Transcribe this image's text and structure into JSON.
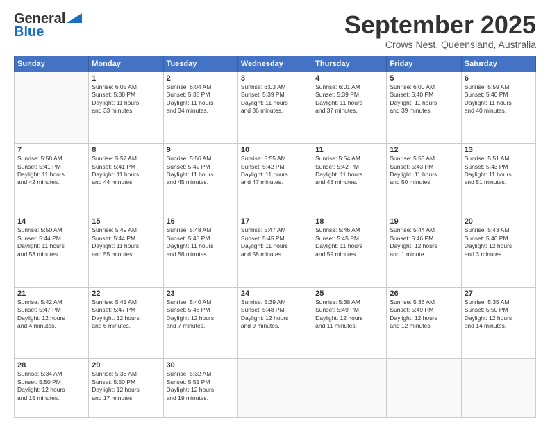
{
  "header": {
    "logo_line1": "General",
    "logo_line2": "Blue",
    "month": "September 2025",
    "location": "Crows Nest, Queensland, Australia"
  },
  "days": [
    "Sunday",
    "Monday",
    "Tuesday",
    "Wednesday",
    "Thursday",
    "Friday",
    "Saturday"
  ],
  "weeks": [
    [
      {
        "num": "",
        "info": ""
      },
      {
        "num": "1",
        "info": "Sunrise: 6:05 AM\nSunset: 5:38 PM\nDaylight: 11 hours\nand 33 minutes."
      },
      {
        "num": "2",
        "info": "Sunrise: 6:04 AM\nSunset: 5:38 PM\nDaylight: 11 hours\nand 34 minutes."
      },
      {
        "num": "3",
        "info": "Sunrise: 6:03 AM\nSunset: 5:39 PM\nDaylight: 11 hours\nand 36 minutes."
      },
      {
        "num": "4",
        "info": "Sunrise: 6:01 AM\nSunset: 5:39 PM\nDaylight: 11 hours\nand 37 minutes."
      },
      {
        "num": "5",
        "info": "Sunrise: 6:00 AM\nSunset: 5:40 PM\nDaylight: 11 hours\nand 39 minutes."
      },
      {
        "num": "6",
        "info": "Sunrise: 5:59 AM\nSunset: 5:40 PM\nDaylight: 11 hours\nand 40 minutes."
      }
    ],
    [
      {
        "num": "7",
        "info": "Sunrise: 5:58 AM\nSunset: 5:41 PM\nDaylight: 11 hours\nand 42 minutes."
      },
      {
        "num": "8",
        "info": "Sunrise: 5:57 AM\nSunset: 5:41 PM\nDaylight: 11 hours\nand 44 minutes."
      },
      {
        "num": "9",
        "info": "Sunrise: 5:56 AM\nSunset: 5:42 PM\nDaylight: 11 hours\nand 45 minutes."
      },
      {
        "num": "10",
        "info": "Sunrise: 5:55 AM\nSunset: 5:42 PM\nDaylight: 11 hours\nand 47 minutes."
      },
      {
        "num": "11",
        "info": "Sunrise: 5:54 AM\nSunset: 5:42 PM\nDaylight: 11 hours\nand 48 minutes."
      },
      {
        "num": "12",
        "info": "Sunrise: 5:53 AM\nSunset: 5:43 PM\nDaylight: 11 hours\nand 50 minutes."
      },
      {
        "num": "13",
        "info": "Sunrise: 5:51 AM\nSunset: 5:43 PM\nDaylight: 11 hours\nand 51 minutes."
      }
    ],
    [
      {
        "num": "14",
        "info": "Sunrise: 5:50 AM\nSunset: 5:44 PM\nDaylight: 11 hours\nand 53 minutes."
      },
      {
        "num": "15",
        "info": "Sunrise: 5:49 AM\nSunset: 5:44 PM\nDaylight: 11 hours\nand 55 minutes."
      },
      {
        "num": "16",
        "info": "Sunrise: 5:48 AM\nSunset: 5:45 PM\nDaylight: 11 hours\nand 56 minutes."
      },
      {
        "num": "17",
        "info": "Sunrise: 5:47 AM\nSunset: 5:45 PM\nDaylight: 11 hours\nand 58 minutes."
      },
      {
        "num": "18",
        "info": "Sunrise: 5:46 AM\nSunset: 5:45 PM\nDaylight: 11 hours\nand 59 minutes."
      },
      {
        "num": "19",
        "info": "Sunrise: 5:44 AM\nSunset: 5:46 PM\nDaylight: 12 hours\nand 1 minute."
      },
      {
        "num": "20",
        "info": "Sunrise: 5:43 AM\nSunset: 5:46 PM\nDaylight: 12 hours\nand 3 minutes."
      }
    ],
    [
      {
        "num": "21",
        "info": "Sunrise: 5:42 AM\nSunset: 5:47 PM\nDaylight: 12 hours\nand 4 minutes."
      },
      {
        "num": "22",
        "info": "Sunrise: 5:41 AM\nSunset: 5:47 PM\nDaylight: 12 hours\nand 6 minutes."
      },
      {
        "num": "23",
        "info": "Sunrise: 5:40 AM\nSunset: 5:48 PM\nDaylight: 12 hours\nand 7 minutes."
      },
      {
        "num": "24",
        "info": "Sunrise: 5:39 AM\nSunset: 5:48 PM\nDaylight: 12 hours\nand 9 minutes."
      },
      {
        "num": "25",
        "info": "Sunrise: 5:38 AM\nSunset: 5:49 PM\nDaylight: 12 hours\nand 11 minutes."
      },
      {
        "num": "26",
        "info": "Sunrise: 5:36 AM\nSunset: 5:49 PM\nDaylight: 12 hours\nand 12 minutes."
      },
      {
        "num": "27",
        "info": "Sunrise: 5:35 AM\nSunset: 5:50 PM\nDaylight: 12 hours\nand 14 minutes."
      }
    ],
    [
      {
        "num": "28",
        "info": "Sunrise: 5:34 AM\nSunset: 5:50 PM\nDaylight: 12 hours\nand 15 minutes."
      },
      {
        "num": "29",
        "info": "Sunrise: 5:33 AM\nSunset: 5:50 PM\nDaylight: 12 hours\nand 17 minutes."
      },
      {
        "num": "30",
        "info": "Sunrise: 5:32 AM\nSunset: 5:51 PM\nDaylight: 12 hours\nand 19 minutes."
      },
      {
        "num": "",
        "info": ""
      },
      {
        "num": "",
        "info": ""
      },
      {
        "num": "",
        "info": ""
      },
      {
        "num": "",
        "info": ""
      }
    ]
  ]
}
